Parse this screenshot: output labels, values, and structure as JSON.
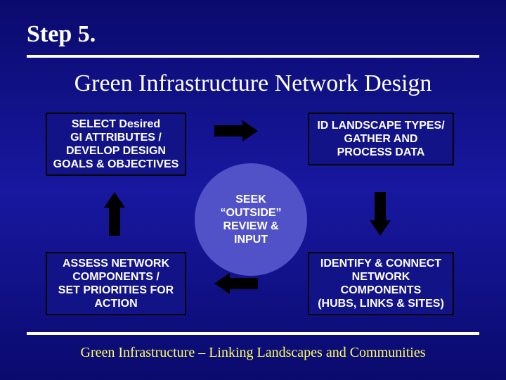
{
  "step_label": "Step 5.",
  "title": "Green Infrastructure Network Design",
  "footer": "Green Infrastructure – Linking Landscapes and Communities",
  "boxes": {
    "top_left": "SELECT Desired\nGI  ATTRIBUTES /\nDEVELOP DESIGN\nGOALS & OBJECTIVES",
    "top_right": "ID LANDSCAPE TYPES/\nGATHER AND\nPROCESS DATA",
    "bottom_right": "IDENTIFY & CONNECT\nNETWORK\nCOMPONENTS\n(HUBS, LINKS & SITES)",
    "bottom_left": "ASSESS NETWORK\nCOMPONENTS /\nSET PRIORITIES FOR\nACTION"
  },
  "center": "SEEK\n“OUTSIDE”\nREVIEW &\nINPUT"
}
